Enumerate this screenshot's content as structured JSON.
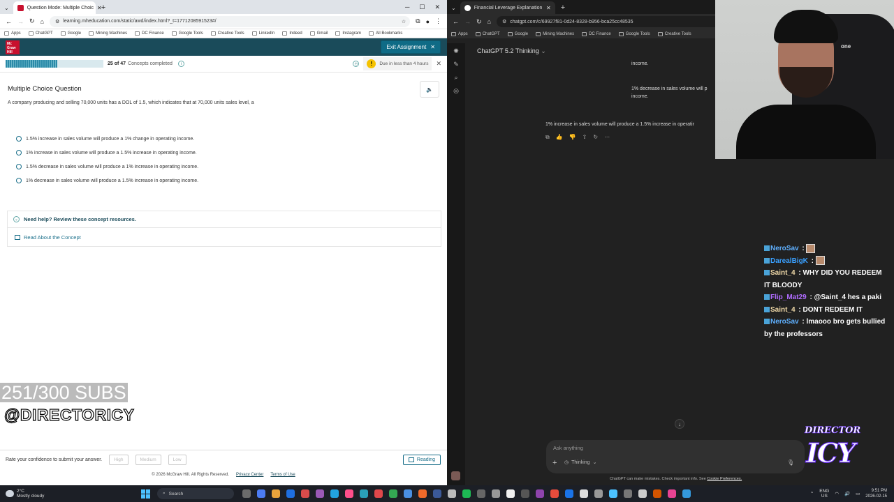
{
  "left_browser": {
    "tab_title": "Question Mode: Multiple Choic",
    "url": "learning.mheducation.com/static/awd/index.html?_t=1771208591523#/",
    "bookmarks": [
      "Apps",
      "ChatGPT",
      "Google",
      "Mining Machines",
      "DC Finance",
      "Google Tools",
      "Creative Tools",
      "LinkedIn",
      "Indeed",
      "Gmail",
      "Instagram",
      "All Bookmarks"
    ],
    "logo_text": "Mc Graw Hill",
    "exit_label": "Exit Assignment",
    "progress": {
      "completed": 25,
      "total": 47,
      "text_count": "25 of 47",
      "text_suffix": "Concepts completed",
      "fraction": 0.532
    },
    "due_text": "Due in less than 4 hours",
    "question_type": "Multiple Choice Question",
    "question_text": "A company producing and selling 70,000 units has a DOL of 1.5, which indicates that at 70,000 units sales level, a",
    "options": [
      "1.5% increase in sales volume will produce a 1% change in operating income.",
      "1% increase in sales volume will produce a 1.5% increase in operating income.",
      "1.5% decrease in sales volume will produce a 1% increase in operating income.",
      "1% decrease in sales volume will produce a 1.5% increase in operating income."
    ],
    "help_text": "Need help? Review these concept resources.",
    "resource_link": "Read About the Concept",
    "confidence_prompt": "Rate your confidence to submit your answer.",
    "confidence_buttons": [
      "High",
      "Medium",
      "Low"
    ],
    "reading_label": "Reading",
    "footer": {
      "copyright": "© 2026 McGraw Hill. All Rights Reserved.",
      "privacy": "Privacy Center",
      "terms": "Terms of Use"
    }
  },
  "overlay": {
    "subs": "251/300 SUBS",
    "handle": "@DIRECTORICY"
  },
  "right_browser": {
    "tab_title": "Financial Leverage Explanation",
    "url": "chatgpt.com/c/69927f81-0d24-8328-b956-bca25cc48535",
    "bookmarks": [
      "Apps",
      "ChatGPT",
      "Google",
      "Mining Machines",
      "DC Finance",
      "Google Tools",
      "Creative Tools"
    ],
    "model_label": "ChatGPT 5.2 Thinking",
    "bubble_line1": "income.",
    "bubble_line2a": "1% decrease in sales volume will p",
    "bubble_line2b": "income.",
    "answer_text": "1% increase in sales volume will produce a 1.5% increase in operatir",
    "composer_placeholder": "Ask anything",
    "thinking_label": "Thinking",
    "disclaimer_text": "ChatGPT can make mistakes. Check important info. See",
    "disclaimer_link": "Cookie Preferences."
  },
  "stream": {
    "chair_brand": "one",
    "chat": [
      {
        "user": "NeroSav",
        "color": "#5fb0ff",
        "msg": ""
      },
      {
        "user": "DarealBigK",
        "color": "#3aa0ff",
        "msg": ""
      },
      {
        "user": "Saint_4",
        "color": "#f0d9a8",
        "msg": "WHY DID YOU REDEEM IT BLOODY"
      },
      {
        "user": "Flip_Mat29",
        "color": "#b06cff",
        "msg": "@Saint_4 hes a paki"
      },
      {
        "user": "Saint_4",
        "color": "#f0d9a8",
        "msg": "DONT REDEEM IT"
      },
      {
        "user": "NeroSav",
        "color": "#5fb0ff",
        "msg": "lmaooo bro gets bullied by the professors"
      }
    ],
    "logo_top": "DIRECTOR",
    "logo_bottom": "ICY"
  },
  "taskbar": {
    "temp": "2°C",
    "condition": "Mostly cloudy",
    "search": "Search",
    "lang1": "ENG",
    "lang2": "US",
    "time": "9:51 PM",
    "date": "2026-02-15"
  }
}
